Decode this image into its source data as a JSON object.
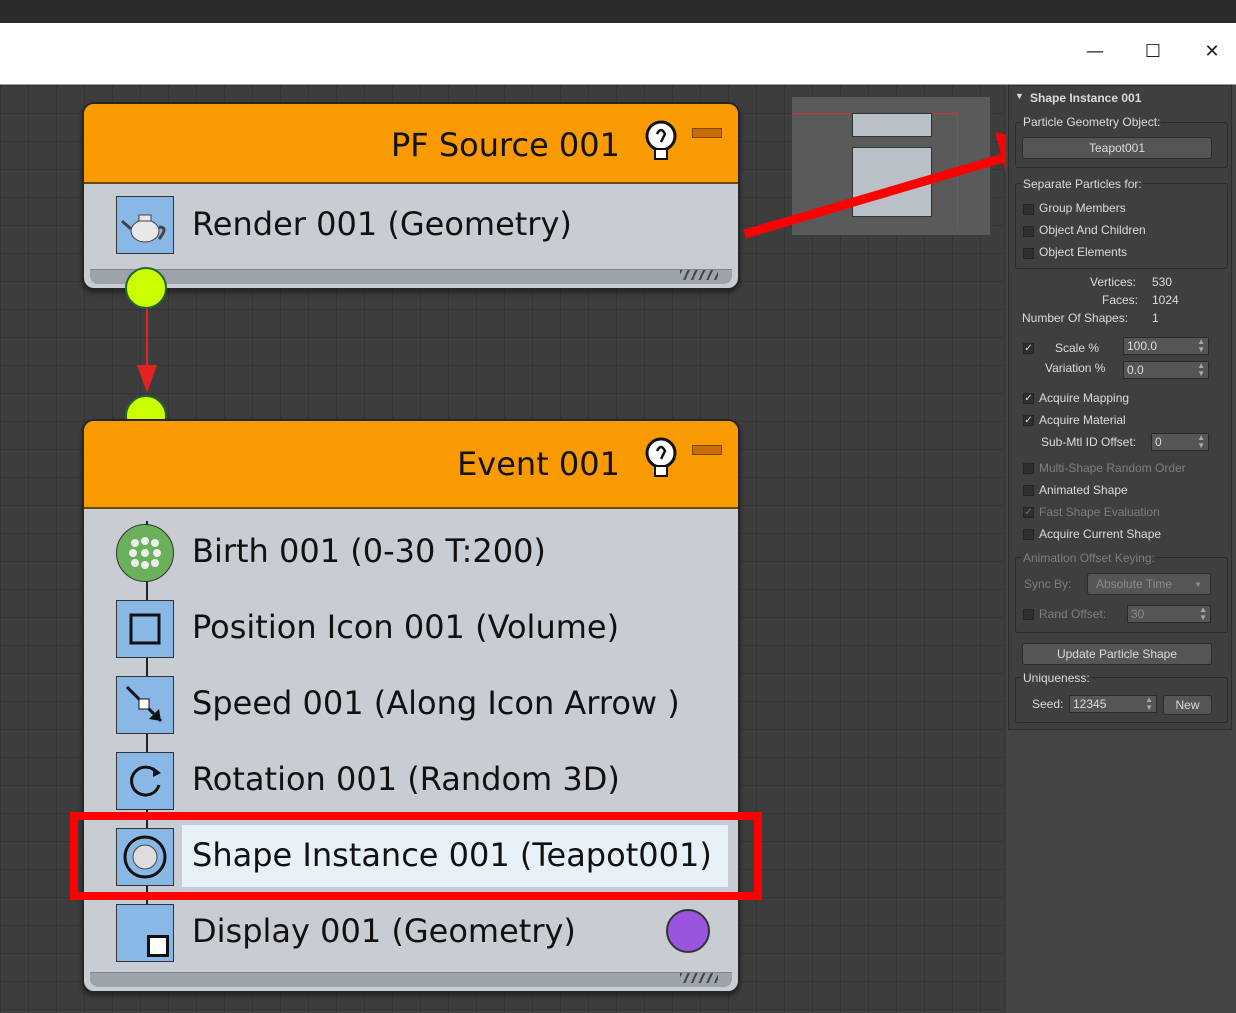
{
  "window": {
    "minimize_glyph": "—",
    "maximize_glyph": "☐",
    "close_glyph": "✕"
  },
  "source_node": {
    "title": "PF Source 001",
    "operators": [
      {
        "label": "Render 001 (Geometry)",
        "icon": "teapot-render-icon"
      }
    ]
  },
  "event_node": {
    "title": "Event 001",
    "operators": [
      {
        "label": "Birth 001 (0-30 T:200)",
        "icon": "birth-icon"
      },
      {
        "label": "Position Icon 001 (Volume)",
        "icon": "position-icon"
      },
      {
        "label": "Speed 001 (Along Icon Arrow )",
        "icon": "speed-icon"
      },
      {
        "label": "Rotation 001 (Random 3D)",
        "icon": "rotation-icon"
      },
      {
        "label": "Shape Instance 001 (Teapot001)",
        "icon": "shape-instance-icon",
        "selected": true
      },
      {
        "label": "Display 001 (Geometry)",
        "icon": "display-icon"
      }
    ]
  },
  "panel": {
    "rollout_title": "Shape Instance 001",
    "particle_geometry_object_label": "Particle Geometry Object:",
    "object_button": "Teapot001",
    "separate_label": "Separate Particles for:",
    "separate_options": [
      "Group Members",
      "Object And Children",
      "Object Elements"
    ],
    "vertices_label": "Vertices:",
    "vertices_value": "530",
    "faces_label": "Faces:",
    "faces_value": "1024",
    "num_shapes_label": "Number Of Shapes:",
    "num_shapes_value": "1",
    "scale_label": "Scale %",
    "scale_value": "100.0",
    "variation_label": "Variation %",
    "variation_value": "0.0",
    "acquire_mapping": "Acquire Mapping",
    "acquire_material": "Acquire Material",
    "submtl_label": "Sub-Mtl ID Offset:",
    "submtl_value": "0",
    "multi_shape": "Multi-Shape Random Order",
    "animated_shape": "Animated Shape",
    "fast_shape": "Fast Shape Evaluation",
    "acquire_current": "Acquire Current Shape",
    "anim_offset_label": "Animation Offset Keying:",
    "sync_by_label": "Sync By:",
    "sync_by_value": "Absolute Time",
    "rand_offset_label": "Rand Offset:",
    "rand_offset_value": "30",
    "update_button": "Update Particle Shape",
    "uniqueness_label": "Uniqueness:",
    "seed_label": "Seed:",
    "seed_value": "12345",
    "new_button": "New"
  },
  "colors": {
    "header_orange": "#f89a00",
    "connector_green": "#ccff00",
    "annotation_red": "#ff0000",
    "display_purple": "#9955dd"
  }
}
